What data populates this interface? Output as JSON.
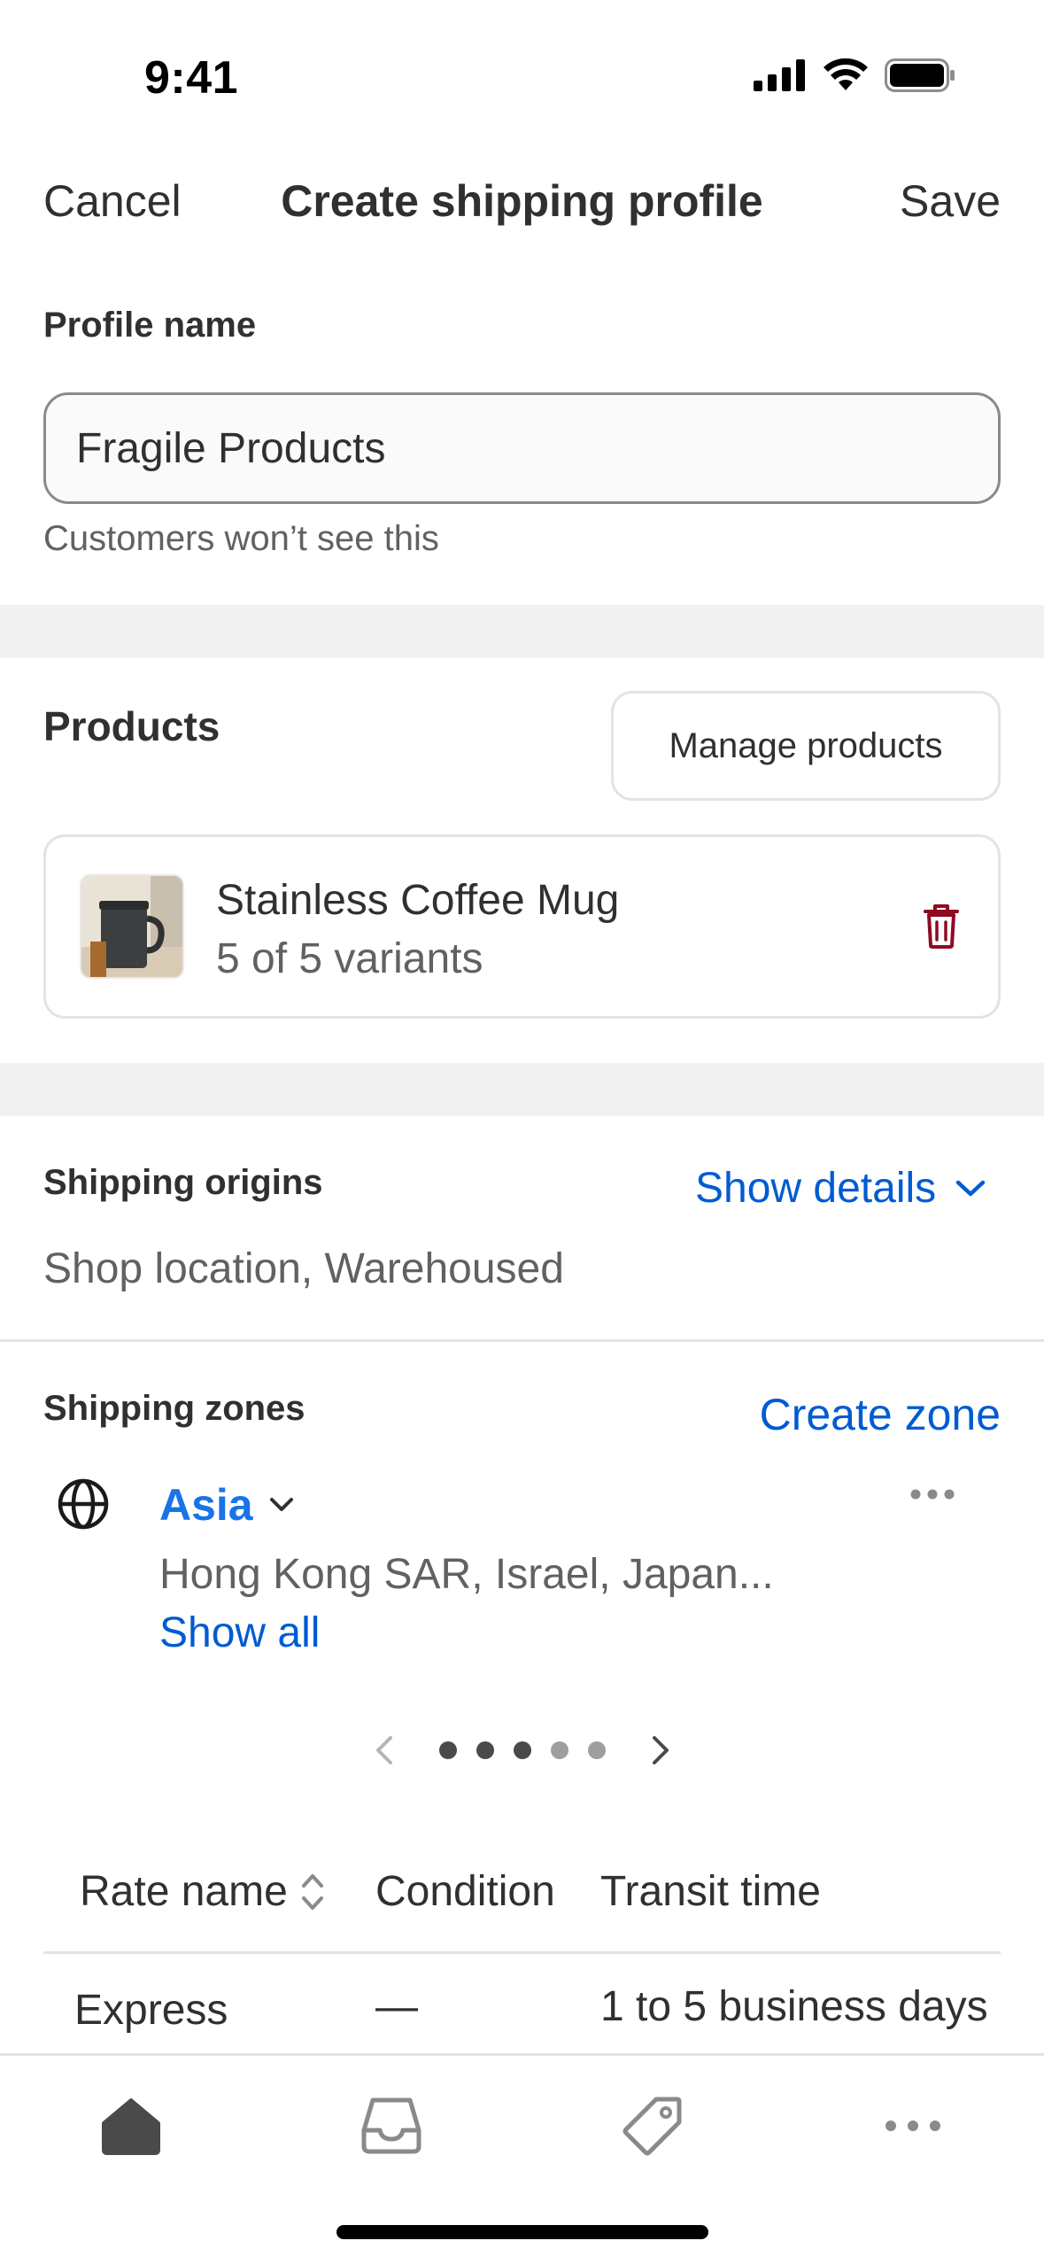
{
  "status_bar": {
    "time": "9:41"
  },
  "nav": {
    "cancel": "Cancel",
    "title": "Create shipping profile",
    "save": "Save"
  },
  "profile": {
    "label": "Profile name",
    "value": "Fragile Products",
    "helper": "Customers won’t see this"
  },
  "products": {
    "heading": "Products",
    "manage_button": "Manage products",
    "items": [
      {
        "name": "Stainless Coffee Mug",
        "variants": "5 of 5 variants"
      }
    ]
  },
  "origins": {
    "heading": "Shipping origins",
    "show_details": "Show details",
    "value": "Shop location, Warehoused"
  },
  "zones": {
    "heading": "Shipping zones",
    "create": "Create zone",
    "zone": {
      "name": "Asia",
      "countries": "Hong Kong SAR, Israel, Japan...",
      "show_all": "Show all"
    },
    "pager": {
      "total": 5,
      "active": 3
    }
  },
  "rates_table": {
    "columns": [
      "Rate name",
      "Condition",
      "Transit time"
    ],
    "rows": [
      {
        "name": "Express",
        "condition": "—",
        "transit": "1 to 5 business days"
      }
    ]
  },
  "icons": {
    "tabs": [
      "home-icon",
      "inbox-icon",
      "tag-icon",
      "more-icon"
    ],
    "delete": "trash-icon",
    "globe": "globe-icon"
  },
  "colors": {
    "link": "#005bd3",
    "zone_link": "#1a73e8",
    "danger": "#8e0b21",
    "band": "#f1f1f1"
  }
}
